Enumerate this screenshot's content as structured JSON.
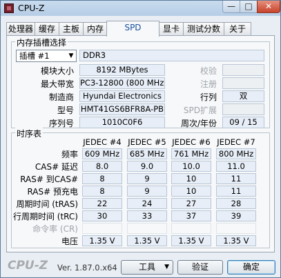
{
  "window": {
    "title": "CPU-Z",
    "minimize": "—",
    "maximize": "□",
    "close": "✕"
  },
  "tabs": [
    "处理器",
    "缓存",
    "主板",
    "内存",
    "SPD",
    "显卡",
    "测试分数",
    "关于"
  ],
  "active_tab": "SPD",
  "slot_group": {
    "title": "内存插槽选择",
    "slot_select": "插槽 #1",
    "memory_type": "DDR3",
    "rows": [
      {
        "label": "模块大小",
        "value": "8192 MBytes",
        "right_label": "校验",
        "right_value": ""
      },
      {
        "label": "最大带宽",
        "value": "PC3-12800 (800 MHz)",
        "right_label": "注册",
        "right_value": ""
      },
      {
        "label": "制造商",
        "value": "Hyundai Electronics",
        "right_label": "行列",
        "right_value": "双"
      },
      {
        "label": "型号",
        "value": "HMT41GS6BFR8A-PB",
        "right_label": "SPD扩展",
        "right_value": ""
      },
      {
        "label": "序列号",
        "value": "1010C0F6",
        "right_label": "周次/年份",
        "right_value": "09 / 15"
      }
    ]
  },
  "timing_group": {
    "title": "时序表",
    "columns": [
      "JEDEC #4",
      "JEDEC #5",
      "JEDEC #6",
      "JEDEC #7"
    ],
    "rows": [
      {
        "label": "频率",
        "values": [
          "609 MHz",
          "685 MHz",
          "761 MHz",
          "800 MHz"
        ]
      },
      {
        "label": "CAS# 延迟",
        "values": [
          "8.0",
          "9.0",
          "10.0",
          "11.0"
        ]
      },
      {
        "label": "RAS# 到CAS#",
        "values": [
          "8",
          "9",
          "10",
          "11"
        ]
      },
      {
        "label": "RAS# 预充电",
        "values": [
          "8",
          "9",
          "10",
          "11"
        ]
      },
      {
        "label": "周期时间 (tRAS)",
        "values": [
          "22",
          "24",
          "27",
          "28"
        ]
      },
      {
        "label": "行周期时间 (tRC)",
        "values": [
          "30",
          "33",
          "37",
          "39"
        ]
      },
      {
        "label": "命令率 (CR)",
        "values": [
          "",
          "",
          "",
          ""
        ]
      },
      {
        "label": "电压",
        "values": [
          "1.35 V",
          "1.35 V",
          "1.35 V",
          "1.35 V"
        ]
      }
    ]
  },
  "footer": {
    "logo": "CPU-Z",
    "version": "Ver. 1.87.0.x64",
    "tools_button": "工具",
    "validate_button": "验证",
    "ok_button": "确定"
  }
}
